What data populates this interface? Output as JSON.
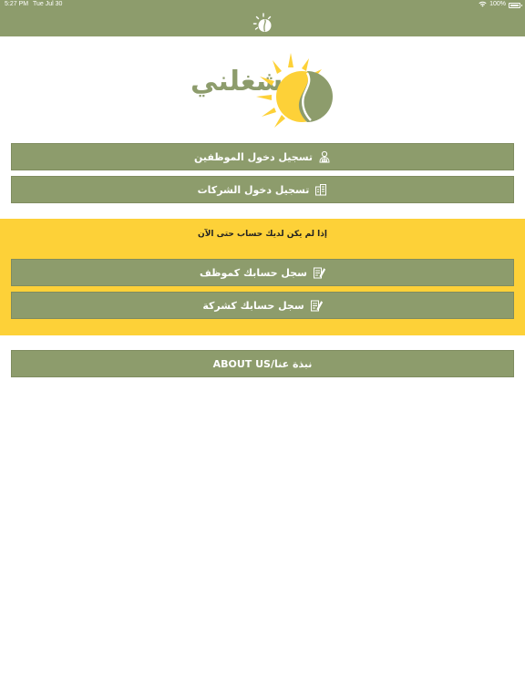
{
  "status_bar": {
    "time": "5:27 PM",
    "date": "Tue Jul 30",
    "battery": "100%",
    "icons": [
      "wifi-icon",
      "battery-icon"
    ]
  },
  "nav": {
    "logo": "sun-coffee-logo"
  },
  "brand": {
    "name": "شغلني"
  },
  "login": {
    "employee_label": "تسجيل دخول الموظفين",
    "company_label": "تسجيل دخول الشركات"
  },
  "register": {
    "prompt": "إذا لم يكن لديك حساب حتى الآن",
    "employee_label": "سجل حسابك كموظف",
    "company_label": "سجل حسابك كشركة"
  },
  "about": {
    "label": "ABOUT US/نبذة عنا"
  },
  "colors": {
    "primary": "#8d9c6c",
    "accent": "#fdd138",
    "background": "#ffffff"
  }
}
